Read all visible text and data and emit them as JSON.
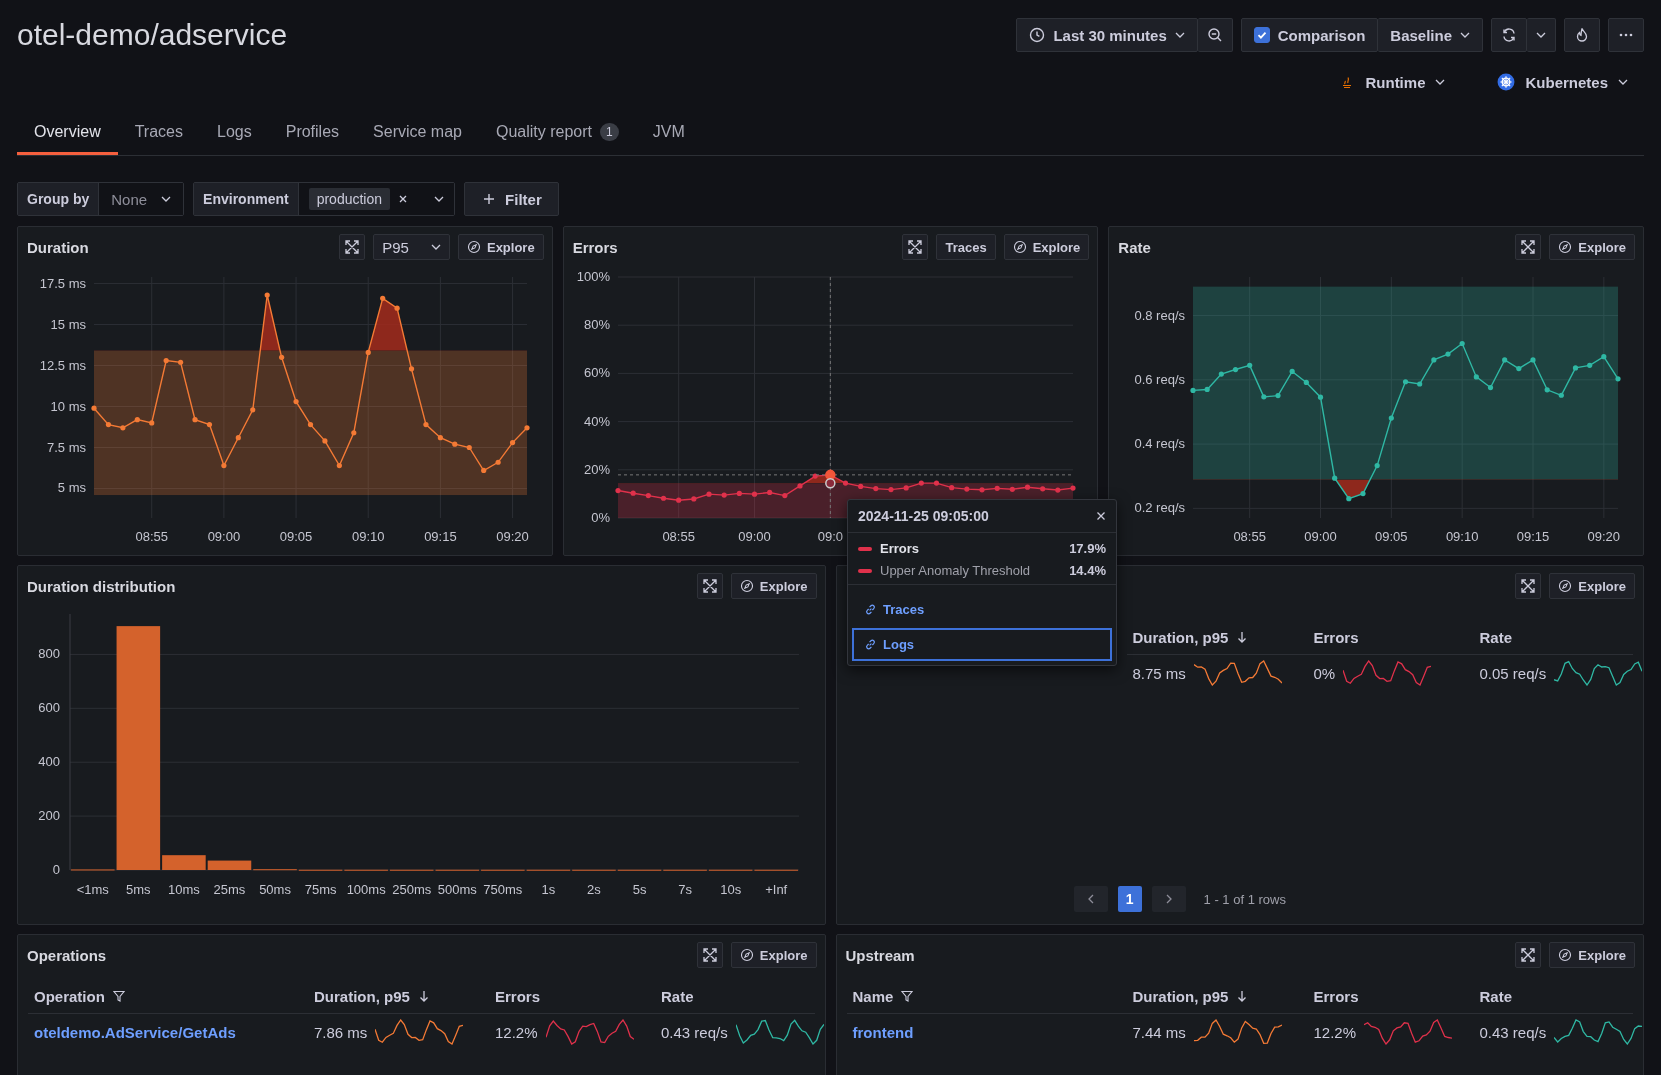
{
  "header": {
    "title": "otel-demo/adservice",
    "time_range": "Last 30 minutes",
    "comparison": {
      "label": "Comparison",
      "checked": true
    },
    "baseline": "Baseline",
    "runtime": "Runtime",
    "platform": "Kubernetes"
  },
  "tabs": [
    {
      "label": "Overview",
      "selected": true
    },
    {
      "label": "Traces",
      "selected": false
    },
    {
      "label": "Logs",
      "selected": false
    },
    {
      "label": "Profiles",
      "selected": false
    },
    {
      "label": "Service map",
      "selected": false
    },
    {
      "label": "Quality report",
      "selected": false,
      "badge": "1"
    },
    {
      "label": "JVM",
      "selected": false
    }
  ],
  "filters": {
    "group_by": {
      "label": "Group by",
      "value": "None"
    },
    "environment": {
      "label": "Environment",
      "value": "production"
    },
    "filter_button": "Filter"
  },
  "overview_panels": [
    {
      "kind": "duration",
      "title": "Duration",
      "percentile": "P95",
      "explore": "Explore",
      "chart_data": {
        "type": "line",
        "grid": true,
        "categories": [
          null,
          null,
          null,
          null,
          "08:55",
          null,
          null,
          null,
          null,
          "09:00",
          null,
          null,
          null,
          null,
          "09:05",
          null,
          null,
          null,
          null,
          "09:10",
          null,
          null,
          null,
          null,
          "09:15",
          null,
          null,
          null,
          null,
          "09:20",
          null
        ],
        "ylim": [
          3.2,
          17.9
        ],
        "yticks": [
          {
            "value": 5,
            "label": "5 ms"
          },
          {
            "value": 7.5,
            "label": "7.5 ms"
          },
          {
            "value": 10,
            "label": "10 ms"
          },
          {
            "value": 12.5,
            "label": "12.5 ms"
          },
          {
            "value": 15,
            "label": "15 ms"
          },
          {
            "value": 17.5,
            "label": "17.5 ms"
          }
        ],
        "series": [
          {
            "color": "#f47a35",
            "values": [
              9.9,
              8.9,
              8.7,
              9.2,
              9.0,
              12.8,
              12.7,
              9.2,
              8.9,
              6.4,
              8.1,
              9.8,
              16.8,
              13.0,
              10.3,
              8.9,
              7.9,
              6.4,
              8.4,
              13.3,
              16.6,
              16.0,
              12.3,
              8.9,
              8.1,
              7.7,
              7.5,
              6.1,
              6.6,
              7.8,
              8.7
            ]
          }
        ],
        "bands": [
          {
            "axis": "y",
            "from": 4.6,
            "to": 13.4
          }
        ]
      }
    },
    {
      "kind": "errors",
      "title": "Errors",
      "traces": "Traces",
      "explore": "Explore",
      "chart_data": {
        "type": "line",
        "grid": true,
        "categories": [
          null,
          null,
          null,
          null,
          "08:55",
          null,
          null,
          null,
          null,
          "09:00",
          null,
          null,
          null,
          null,
          "09:0",
          null,
          null,
          null,
          null,
          null,
          null,
          null,
          null,
          null,
          null,
          null,
          null,
          null,
          null,
          null,
          null
        ],
        "ylim": [
          0,
          100
        ],
        "yticks": [
          {
            "value": 0,
            "label": "0%"
          },
          {
            "value": 20,
            "label": "20%"
          },
          {
            "value": 40,
            "label": "40%"
          },
          {
            "value": 60,
            "label": "60%"
          },
          {
            "value": 80,
            "label": "80%"
          },
          {
            "value": 100,
            "label": "100%"
          }
        ],
        "series": [
          {
            "color": "#e0314b",
            "values": [
              11.4,
              10.3,
              9.3,
              8.2,
              7.4,
              7.9,
              9.9,
              9.5,
              10.2,
              9.9,
              10.6,
              9.3,
              13.3,
              17.4,
              17.9,
              14.5,
              13.1,
              12.2,
              11.8,
              12.5,
              14.5,
              14.5,
              12.6,
              12.0,
              11.7,
              12.3,
              11.9,
              12.8,
              12.1,
              11.6,
              12.4
            ]
          }
        ],
        "bands": [
          {
            "axis": "y",
            "from": 0,
            "to": 14.4
          }
        ],
        "ref_lines": [
          {
            "axis": "y",
            "value": 17.9
          }
        ]
      }
    },
    {
      "kind": "rate",
      "title": "Rate",
      "explore": "Explore",
      "chart_data": {
        "type": "line",
        "grid": true,
        "categories": [
          null,
          null,
          null,
          null,
          "08:55",
          null,
          null,
          null,
          null,
          "09:00",
          null,
          null,
          null,
          null,
          "09:05",
          null,
          null,
          null,
          null,
          "09:10",
          null,
          null,
          null,
          null,
          "09:15",
          null,
          null,
          null,
          null,
          "09:20",
          null
        ],
        "ylim": [
          0.17,
          0.92
        ],
        "yticks": [
          {
            "value": 0.2,
            "label": "0.2 req/s"
          },
          {
            "value": 0.4,
            "label": "0.4 req/s"
          },
          {
            "value": 0.6,
            "label": "0.6 req/s"
          },
          {
            "value": 0.8,
            "label": "0.8 req/s"
          }
        ],
        "series": [
          {
            "color": "#2fb8a4",
            "values": [
              0.567,
              0.57,
              0.618,
              0.632,
              0.645,
              0.547,
              0.551,
              0.626,
              0.592,
              0.546,
              0.294,
              0.23,
              0.246,
              0.333,
              0.481,
              0.594,
              0.587,
              0.662,
              0.68,
              0.713,
              0.609,
              0.576,
              0.662,
              0.635,
              0.662,
              0.569,
              0.552,
              0.637,
              0.645,
              0.672,
              0.603
            ]
          }
        ],
        "bands": [
          {
            "axis": "y",
            "from": 0.29,
            "to": 0.89
          }
        ]
      }
    }
  ],
  "distribution": {
    "title": "Duration distribution",
    "explore": "Explore",
    "chart_data": {
      "type": "bar",
      "grid": true,
      "categories": [
        "<1ms",
        "5ms",
        "10ms",
        "25ms",
        "50ms",
        "75ms",
        "100ms",
        "250ms",
        "500ms",
        "750ms",
        "1s",
        "2s",
        "5s",
        "7s",
        "10s",
        "+Inf"
      ],
      "ylim": [
        0,
        950
      ],
      "yticks": [
        0,
        200,
        400,
        600,
        800
      ],
      "series": [
        {
          "color": "#d4622c",
          "values": [
            2,
            905,
            55,
            35,
            3,
            1,
            1,
            1,
            1,
            1,
            1,
            1,
            1,
            1,
            1,
            1
          ]
        }
      ]
    }
  },
  "downstream": {
    "explore": "Explore",
    "columns": [
      {
        "label": "Duration, p95",
        "kind": "duration",
        "filterable": false,
        "sorted": true
      },
      {
        "label": "Errors",
        "kind": "errors",
        "filterable": false,
        "sorted": false
      },
      {
        "label": "Rate",
        "kind": "rate",
        "filterable": false,
        "sorted": false
      }
    ],
    "rows": [
      {
        "cells": [
          "8.75 ms",
          "0%",
          "0.05 req/s"
        ]
      }
    ],
    "pagination": {
      "pages": [
        {
          "label": "1",
          "selected": true
        }
      ],
      "summary": "1 - 1 of 1 rows"
    }
  },
  "operations": {
    "title": "Operations",
    "explore": "Explore",
    "columns": [
      {
        "label": "Operation",
        "kind": "name",
        "filterable": true,
        "sorted": false
      },
      {
        "label": "Duration, p95",
        "kind": "duration",
        "filterable": false,
        "sorted": true
      },
      {
        "label": "Errors",
        "kind": "errors",
        "filterable": false,
        "sorted": false
      },
      {
        "label": "Rate",
        "kind": "rate",
        "filterable": false,
        "sorted": false
      }
    ],
    "rows": [
      {
        "cells": [
          "oteldemo.AdService/GetAds",
          "7.86 ms",
          "12.2%",
          "0.43 req/s"
        ]
      }
    ]
  },
  "upstream": {
    "title": "Upstream",
    "explore": "Explore",
    "columns": [
      {
        "label": "Name",
        "kind": "name",
        "filterable": true,
        "sorted": false
      },
      {
        "label": "Duration, p95",
        "kind": "duration",
        "filterable": false,
        "sorted": true
      },
      {
        "label": "Errors",
        "kind": "errors",
        "filterable": false,
        "sorted": false
      },
      {
        "label": "Rate",
        "kind": "rate",
        "filterable": false,
        "sorted": false
      }
    ],
    "rows": [
      {
        "cells": [
          "frontend",
          "7.44 ms",
          "12.2%",
          "0.43 req/s"
        ]
      }
    ]
  },
  "tooltip": {
    "time": "2024-11-25 09:05:00",
    "series": [
      {
        "name": "Errors",
        "value": "17.9%",
        "color": "#e0314b",
        "kind": "series"
      },
      {
        "name": "Upper Anomaly Threshold",
        "value": "14.4%",
        "color": "#e0314b",
        "kind": "threshold"
      }
    ],
    "links": [
      {
        "label": "Traces",
        "selected": false
      },
      {
        "label": "Logs",
        "selected": true
      }
    ]
  }
}
